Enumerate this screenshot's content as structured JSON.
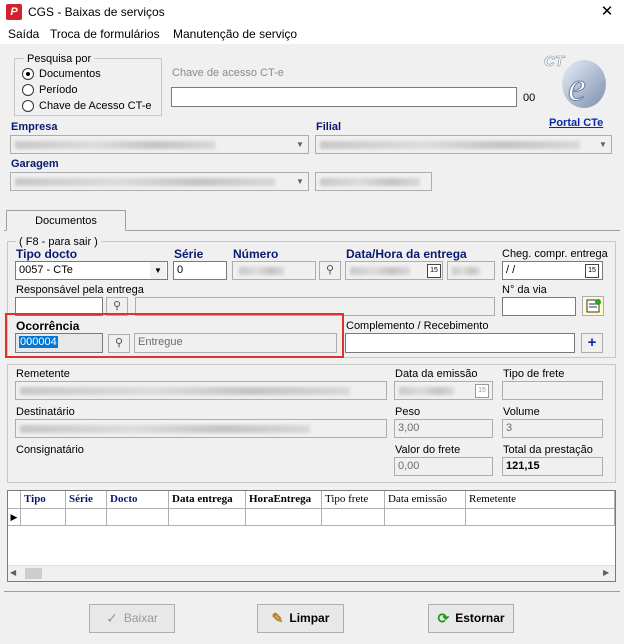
{
  "window": {
    "title": "CGS - Baixas de serviços",
    "close_glyph": "✕"
  },
  "menu": [
    "Saída",
    "Troca de formulários",
    "Manutenção de serviço"
  ],
  "pesquisa": {
    "label": "Pesquisa por",
    "options": [
      "Documentos",
      "Período",
      "Chave de Acesso CT-e"
    ],
    "selected": 0
  },
  "chave": {
    "label": "Chave de acesso CT-e",
    "value": "",
    "suffix": "00"
  },
  "logo": {
    "text": "CT e"
  },
  "portal_link": "Portal CTe",
  "empresa": {
    "label": "Empresa"
  },
  "filial": {
    "label": "Filial"
  },
  "garagem": {
    "label": "Garagem"
  },
  "tab": {
    "label": "Documentos"
  },
  "hint": "( F8 - para sair )",
  "tipo_docto": {
    "label": "Tipo docto",
    "value": "0057 - CTe"
  },
  "serie": {
    "label": "Série",
    "value": "0"
  },
  "numero": {
    "label": "Número"
  },
  "data_hora": {
    "label": "Data/Hora da entrega"
  },
  "cheg": {
    "label": "Cheg. compr. entrega",
    "value": " /  /"
  },
  "responsavel": {
    "label": "Responsável pela entrega"
  },
  "nvia": {
    "label": "N° da via"
  },
  "ocorrencia": {
    "label": "Ocorrência",
    "code": "000004",
    "desc": "Entregue"
  },
  "complemento": {
    "label": "Complemento / Recebimento",
    "value": ""
  },
  "remetente": {
    "label": "Remetente"
  },
  "data_emissao": {
    "label": "Data da emissão"
  },
  "tipo_frete": {
    "label": "Tipo de frete"
  },
  "destinatario": {
    "label": "Destinatário"
  },
  "peso": {
    "label": "Peso",
    "value": "3,00"
  },
  "volume": {
    "label": "Volume",
    "value": "3"
  },
  "consignatario": {
    "label": "Consignatário"
  },
  "valor_frete": {
    "label": "Valor do frete",
    "value": "0,00"
  },
  "total_prestacao": {
    "label": "Total da prestação",
    "value": "121,15"
  },
  "grid": {
    "columns": [
      "Tipo",
      "Série",
      "Docto",
      "Data entrega",
      "HoraEntrega",
      "Tipo frete",
      "Data emissão",
      "Remetente"
    ]
  },
  "buttons": {
    "baixar": "Baixar",
    "limpar": "Limpar",
    "estornar": "Estornar"
  }
}
